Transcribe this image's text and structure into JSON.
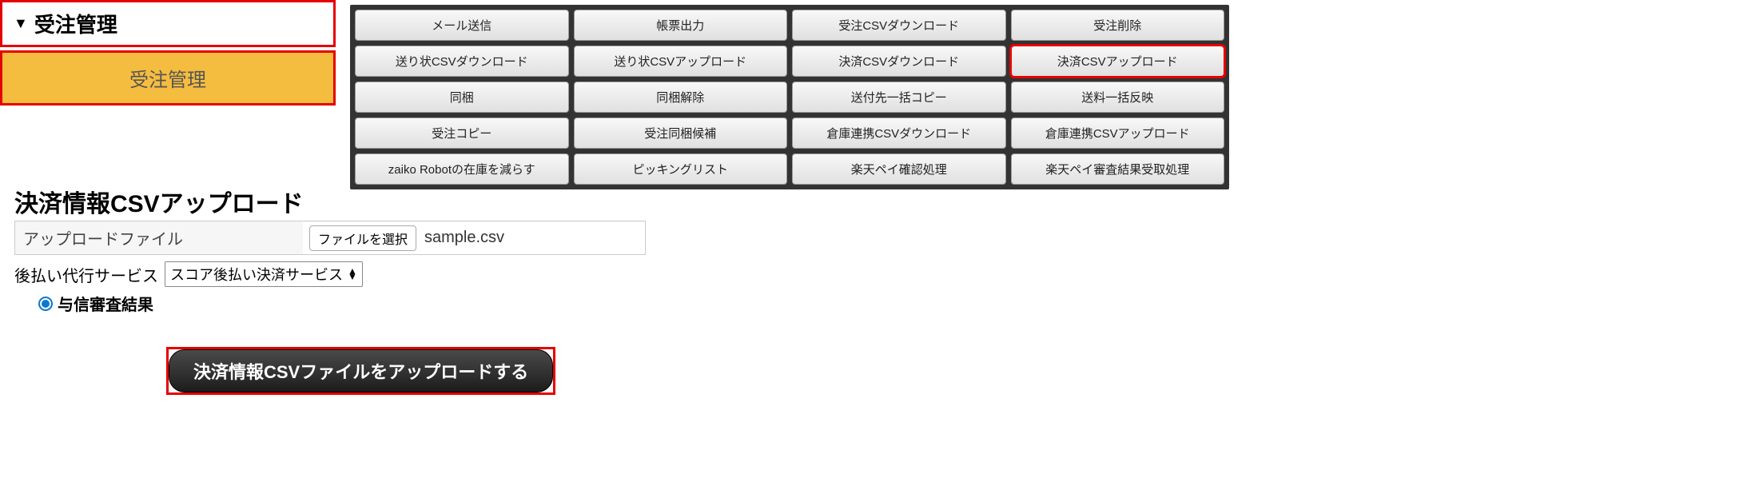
{
  "sidebar": {
    "header": "受注管理",
    "item": "受注管理"
  },
  "toolbar": {
    "buttons": [
      {
        "label": "メール送信",
        "highlight": false
      },
      {
        "label": "帳票出力",
        "highlight": false
      },
      {
        "label": "受注CSVダウンロード",
        "highlight": false
      },
      {
        "label": "受注削除",
        "highlight": false
      },
      {
        "label": "送り状CSVダウンロード",
        "highlight": false
      },
      {
        "label": "送り状CSVアップロード",
        "highlight": false
      },
      {
        "label": "決済CSVダウンロード",
        "highlight": false
      },
      {
        "label": "決済CSVアップロード",
        "highlight": true
      },
      {
        "label": "同梱",
        "highlight": false
      },
      {
        "label": "同梱解除",
        "highlight": false
      },
      {
        "label": "送付先一括コピー",
        "highlight": false
      },
      {
        "label": "送料一括反映",
        "highlight": false
      },
      {
        "label": "受注コピー",
        "highlight": false
      },
      {
        "label": "受注同梱候補",
        "highlight": false
      },
      {
        "label": "倉庫連携CSVダウンロード",
        "highlight": false
      },
      {
        "label": "倉庫連携CSVアップロード",
        "highlight": false
      },
      {
        "label": "zaiko Robotの在庫を減らす",
        "highlight": false
      },
      {
        "label": "ピッキングリスト",
        "highlight": false
      },
      {
        "label": "楽天ペイ確認処理",
        "highlight": false
      },
      {
        "label": "楽天ペイ審査結果受取処理",
        "highlight": false
      }
    ]
  },
  "form": {
    "title": "決済情報CSVアップロード",
    "upload_label": "アップロードファイル",
    "file_button_label": "ファイルを選択",
    "file_name": "sample.csv",
    "service_label": "後払い代行サービス",
    "service_selected": "スコア後払い決済サービス",
    "radio_label": "与信審査結果",
    "submit_label": "決済情報CSVファイルをアップロードする"
  }
}
